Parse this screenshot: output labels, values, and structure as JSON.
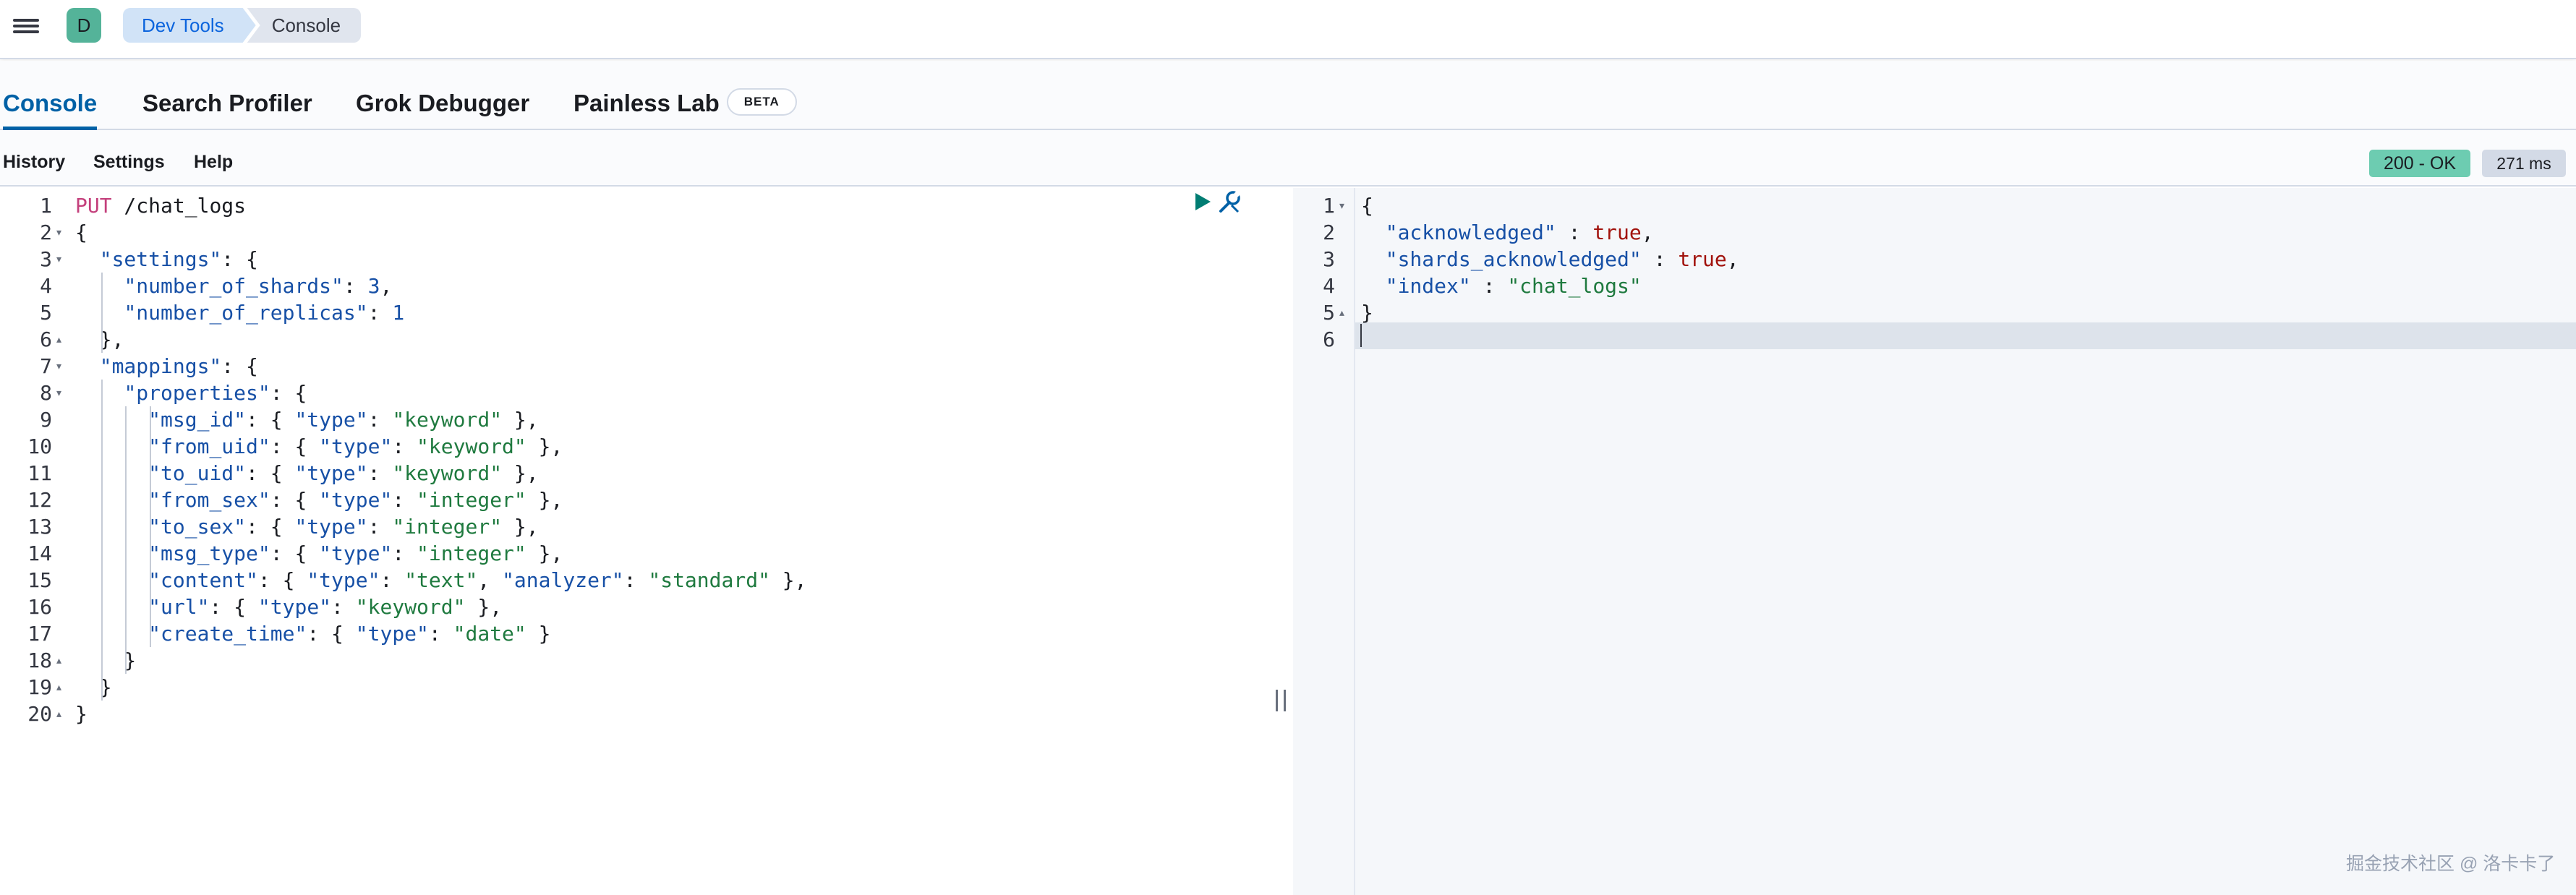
{
  "header": {
    "avatar_letter": "D",
    "breadcrumbs": [
      "Dev Tools",
      "Console"
    ]
  },
  "tabs": [
    {
      "label": "Console",
      "active": true
    },
    {
      "label": "Search Profiler",
      "active": false
    },
    {
      "label": "Grok Debugger",
      "active": false
    },
    {
      "label": "Painless Lab",
      "active": false,
      "badge": "BETA"
    }
  ],
  "toolbar": {
    "history": "History",
    "settings": "Settings",
    "help": "Help"
  },
  "response_status": {
    "status": "200 - OK",
    "time": "271 ms"
  },
  "request_editor": {
    "lines": [
      [
        [
          "k-method",
          "PUT"
        ],
        [
          "k-path",
          " /chat_logs"
        ]
      ],
      [
        [
          "k-punc",
          "{"
        ]
      ],
      [
        [
          "k-punc",
          "  "
        ],
        [
          "k-key",
          "\"settings\""
        ],
        [
          "k-punc",
          ": {"
        ]
      ],
      [
        [
          "k-punc",
          "    "
        ],
        [
          "k-key",
          "\"number_of_shards\""
        ],
        [
          "k-punc",
          ": "
        ],
        [
          "k-num",
          "3"
        ],
        [
          "k-punc",
          ","
        ]
      ],
      [
        [
          "k-punc",
          "    "
        ],
        [
          "k-key",
          "\"number_of_replicas\""
        ],
        [
          "k-punc",
          ": "
        ],
        [
          "k-num",
          "1"
        ]
      ],
      [
        [
          "k-punc",
          "  },"
        ]
      ],
      [
        [
          "k-punc",
          "  "
        ],
        [
          "k-key",
          "\"mappings\""
        ],
        [
          "k-punc",
          ": {"
        ]
      ],
      [
        [
          "k-punc",
          "    "
        ],
        [
          "k-key",
          "\"properties\""
        ],
        [
          "k-punc",
          ": {"
        ]
      ],
      [
        [
          "k-punc",
          "      "
        ],
        [
          "k-key",
          "\"msg_id\""
        ],
        [
          "k-punc",
          ": { "
        ],
        [
          "k-key",
          "\"type\""
        ],
        [
          "k-punc",
          ": "
        ],
        [
          "k-str",
          "\"keyword\""
        ],
        [
          "k-punc",
          " },"
        ]
      ],
      [
        [
          "k-punc",
          "      "
        ],
        [
          "k-key",
          "\"from_uid\""
        ],
        [
          "k-punc",
          ": { "
        ],
        [
          "k-key",
          "\"type\""
        ],
        [
          "k-punc",
          ": "
        ],
        [
          "k-str",
          "\"keyword\""
        ],
        [
          "k-punc",
          " },"
        ]
      ],
      [
        [
          "k-punc",
          "      "
        ],
        [
          "k-key",
          "\"to_uid\""
        ],
        [
          "k-punc",
          ": { "
        ],
        [
          "k-key",
          "\"type\""
        ],
        [
          "k-punc",
          ": "
        ],
        [
          "k-str",
          "\"keyword\""
        ],
        [
          "k-punc",
          " },"
        ]
      ],
      [
        [
          "k-punc",
          "      "
        ],
        [
          "k-key",
          "\"from_sex\""
        ],
        [
          "k-punc",
          ": { "
        ],
        [
          "k-key",
          "\"type\""
        ],
        [
          "k-punc",
          ": "
        ],
        [
          "k-str",
          "\"integer\""
        ],
        [
          "k-punc",
          " },"
        ]
      ],
      [
        [
          "k-punc",
          "      "
        ],
        [
          "k-key",
          "\"to_sex\""
        ],
        [
          "k-punc",
          ": { "
        ],
        [
          "k-key",
          "\"type\""
        ],
        [
          "k-punc",
          ": "
        ],
        [
          "k-str",
          "\"integer\""
        ],
        [
          "k-punc",
          " },"
        ]
      ],
      [
        [
          "k-punc",
          "      "
        ],
        [
          "k-key",
          "\"msg_type\""
        ],
        [
          "k-punc",
          ": { "
        ],
        [
          "k-key",
          "\"type\""
        ],
        [
          "k-punc",
          ": "
        ],
        [
          "k-str",
          "\"integer\""
        ],
        [
          "k-punc",
          " },"
        ]
      ],
      [
        [
          "k-punc",
          "      "
        ],
        [
          "k-key",
          "\"content\""
        ],
        [
          "k-punc",
          ": { "
        ],
        [
          "k-key",
          "\"type\""
        ],
        [
          "k-punc",
          ": "
        ],
        [
          "k-str",
          "\"text\""
        ],
        [
          "k-punc",
          ", "
        ],
        [
          "k-key",
          "\"analyzer\""
        ],
        [
          "k-punc",
          ": "
        ],
        [
          "k-str",
          "\"standard\""
        ],
        [
          "k-punc",
          " },"
        ]
      ],
      [
        [
          "k-punc",
          "      "
        ],
        [
          "k-key",
          "\"url\""
        ],
        [
          "k-punc",
          ": { "
        ],
        [
          "k-key",
          "\"type\""
        ],
        [
          "k-punc",
          ": "
        ],
        [
          "k-str",
          "\"keyword\""
        ],
        [
          "k-punc",
          " },"
        ]
      ],
      [
        [
          "k-punc",
          "      "
        ],
        [
          "k-key",
          "\"create_time\""
        ],
        [
          "k-punc",
          ": { "
        ],
        [
          "k-key",
          "\"type\""
        ],
        [
          "k-punc",
          ": "
        ],
        [
          "k-str",
          "\"date\""
        ],
        [
          "k-punc",
          " }"
        ]
      ],
      [
        [
          "k-punc",
          "    }"
        ]
      ],
      [
        [
          "k-punc",
          "  }"
        ]
      ],
      [
        [
          "k-punc",
          "}"
        ]
      ]
    ],
    "folds": [
      "",
      "▾",
      "▾",
      "",
      "",
      "▴",
      "▾",
      "▾",
      "",
      "",
      "",
      "",
      "",
      "",
      "",
      "",
      "",
      "▴",
      "▴",
      "▴"
    ]
  },
  "response_editor": {
    "lines": [
      [
        [
          "k-punc",
          "{"
        ]
      ],
      [
        [
          "k-punc",
          "  "
        ],
        [
          "k-key",
          "\"acknowledged\""
        ],
        [
          "k-punc",
          " : "
        ],
        [
          "k-bool",
          "true"
        ],
        [
          "k-punc",
          ","
        ]
      ],
      [
        [
          "k-punc",
          "  "
        ],
        [
          "k-key",
          "\"shards_acknowledged\""
        ],
        [
          "k-punc",
          " : "
        ],
        [
          "k-bool",
          "true"
        ],
        [
          "k-punc",
          ","
        ]
      ],
      [
        [
          "k-punc",
          "  "
        ],
        [
          "k-key",
          "\"index\""
        ],
        [
          "k-punc",
          " : "
        ],
        [
          "k-str",
          "\"chat_logs\""
        ]
      ],
      [
        [
          "k-punc",
          "}"
        ]
      ],
      [
        [
          "k-punc",
          ""
        ]
      ]
    ],
    "folds": [
      "▾",
      "",
      "",
      "",
      "▴",
      ""
    ]
  },
  "watermark": "掘金技术社区 @ 洛卡卡了",
  "colors": {
    "accent": "#0061a6",
    "status_ok": "#6dccb1",
    "avatar": "#54b399"
  }
}
